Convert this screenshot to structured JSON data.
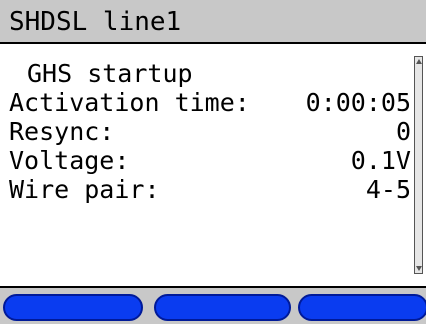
{
  "title_bar": {
    "title": "SHDSL line1"
  },
  "main": {
    "status": "GHS startup",
    "rows": [
      {
        "label": "Activation time:",
        "value": "0:00:05"
      },
      {
        "label": "Resync:",
        "value": "0"
      },
      {
        "label": "Voltage:",
        "value": "0.1V"
      },
      {
        "label": "Wire pair:",
        "value": "4-5"
      }
    ]
  },
  "softkeys": [
    {
      "label": ""
    },
    {
      "label": ""
    },
    {
      "label": ""
    }
  ],
  "colors": {
    "title_bar_bg": "#c8c8c8",
    "softkey_blue": "#0a3cf0",
    "background": "#ffffff",
    "text": "#000000"
  }
}
